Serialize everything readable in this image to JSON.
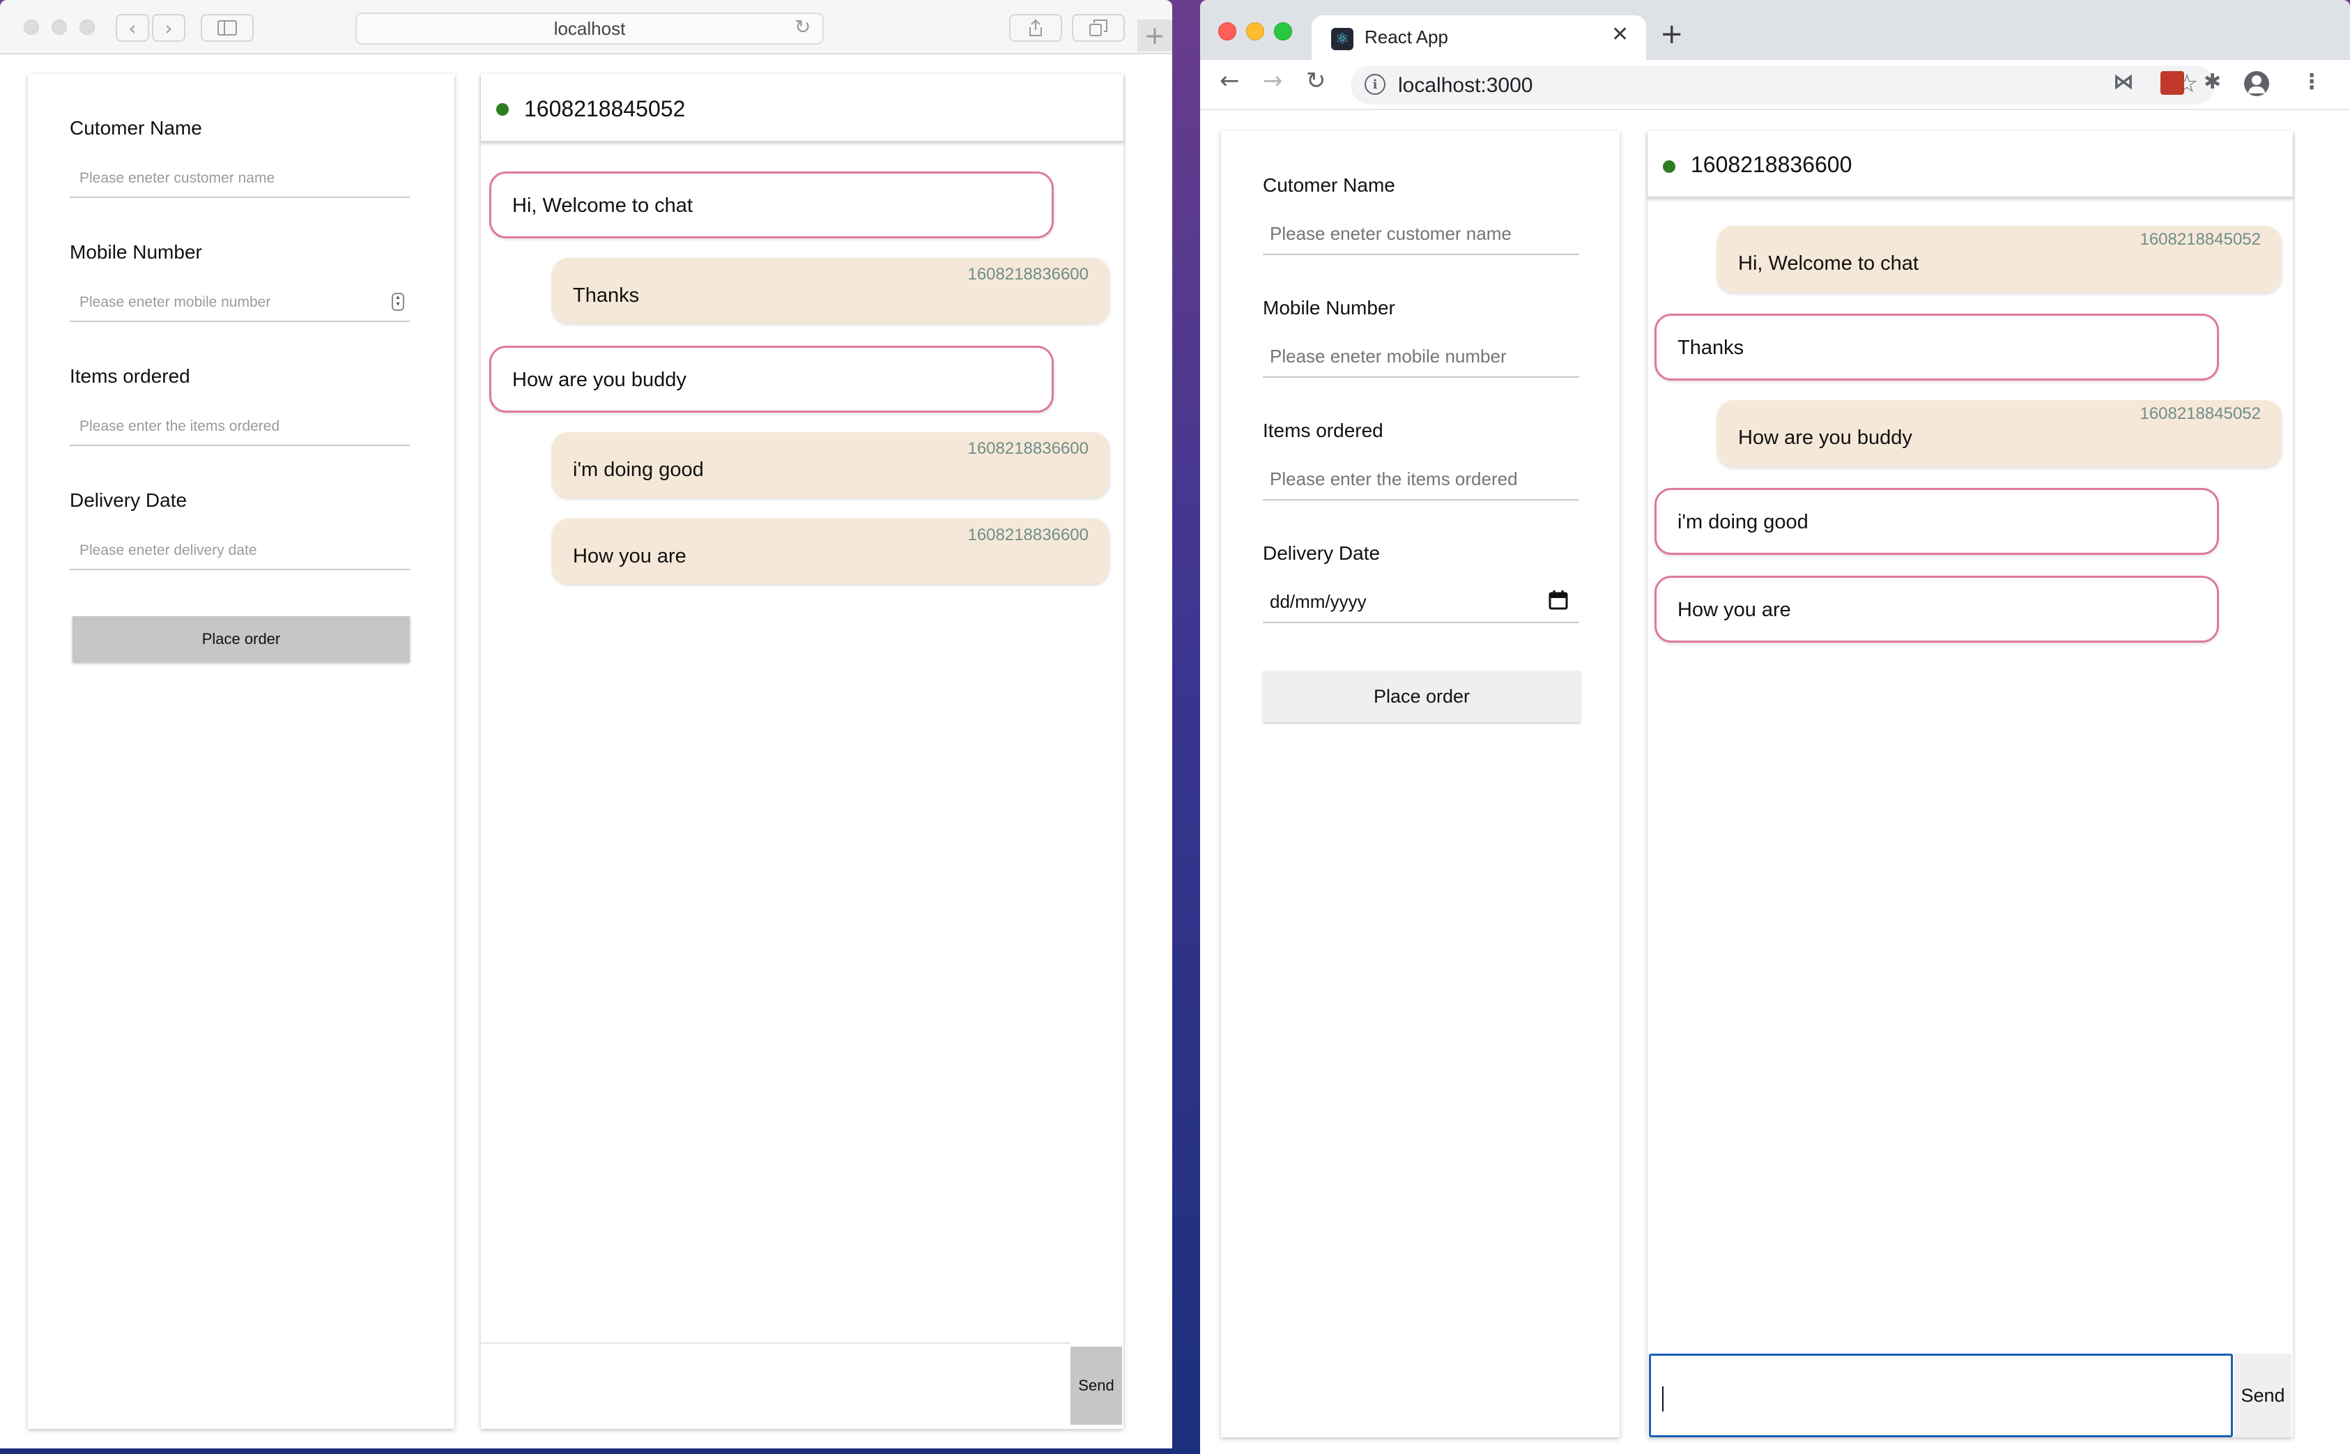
{
  "safari": {
    "url": "localhost",
    "form": {
      "name_label": "Cutomer Name",
      "name_placeholder": "Please eneter customer name",
      "mobile_label": "Mobile Number",
      "mobile_placeholder": "Please eneter mobile number",
      "items_label": "Items ordered",
      "items_placeholder": "Please enter the items ordered",
      "date_label": "Delivery Date",
      "date_placeholder": "Please eneter delivery date",
      "place_order": "Place order"
    },
    "chat": {
      "header_id": "1608218845052",
      "messages": [
        {
          "text": "Hi, Welcome to chat",
          "sender": ""
        },
        {
          "text": "Thanks",
          "sender": "1608218836600"
        },
        {
          "text": "How are you buddy",
          "sender": ""
        },
        {
          "text": "i'm doing good",
          "sender": "1608218836600"
        },
        {
          "text": "How you are",
          "sender": "1608218836600"
        }
      ],
      "input_value": "",
      "send_label": "Send"
    }
  },
  "chrome": {
    "tab_title": "React App",
    "url": "localhost:3000",
    "form": {
      "name_label": "Cutomer Name",
      "name_placeholder": "Please eneter customer name",
      "mobile_label": "Mobile Number",
      "mobile_placeholder": "Please eneter mobile number",
      "items_label": "Items ordered",
      "items_placeholder": "Please enter the items ordered",
      "date_label": "Delivery Date",
      "date_value": "dd/mm/yyyy",
      "place_order": "Place order"
    },
    "chat": {
      "header_id": "1608218836600",
      "messages": [
        {
          "text": "Hi, Welcome to chat",
          "sender": "1608218845052"
        },
        {
          "text": "Thanks",
          "sender": ""
        },
        {
          "text": "How are you buddy",
          "sender": "1608218845052"
        },
        {
          "text": "i'm doing good",
          "sender": ""
        },
        {
          "text": "How you are",
          "sender": ""
        }
      ],
      "input_value": "",
      "send_label": "Send"
    }
  },
  "colors": {
    "incoming_border": "#e07a98",
    "outgoing_bg": "#f6e8d8",
    "online_dot": "#2e7d22",
    "sender_text": "#6e8e8a",
    "button_gray": "#c6c6c6",
    "focus_blue": "#1a5fb4"
  },
  "icons": [
    "back-icon",
    "forward-icon",
    "sidebar-icon",
    "reload-icon",
    "share-icon",
    "tabs-icon",
    "react-logo-icon",
    "close-icon",
    "plus-icon",
    "info-icon",
    "star-icon",
    "extension-icon",
    "profile-icon",
    "menu-icon",
    "calendar-icon",
    "stepper-icon"
  ]
}
